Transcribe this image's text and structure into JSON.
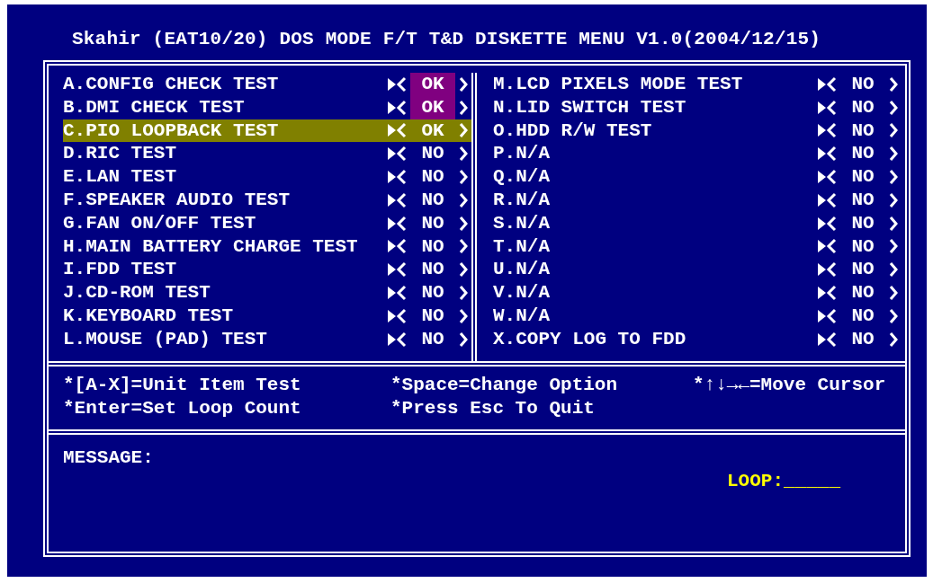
{
  "title": "Skahir (EAT10/20) DOS MODE F/T T&D DISKETTE MENU V1.0(2004/12/15)",
  "columns": [
    {
      "items": [
        {
          "label": "A.CONFIG CHECK TEST",
          "value": "OK",
          "marked": true,
          "selected": false
        },
        {
          "label": "B.DMI CHECK TEST",
          "value": "OK",
          "marked": true,
          "selected": false
        },
        {
          "label": "C.PIO LOOPBACK TEST",
          "value": "OK",
          "marked": false,
          "selected": true
        },
        {
          "label": "D.RIC TEST",
          "value": "NO",
          "marked": false,
          "selected": false
        },
        {
          "label": "E.LAN TEST",
          "value": "NO",
          "marked": false,
          "selected": false
        },
        {
          "label": "F.SPEAKER AUDIO TEST",
          "value": "NO",
          "marked": false,
          "selected": false
        },
        {
          "label": "G.FAN ON/OFF TEST",
          "value": "NO",
          "marked": false,
          "selected": false
        },
        {
          "label": "H.MAIN BATTERY CHARGE TEST",
          "value": "NO",
          "marked": false,
          "selected": false
        },
        {
          "label": "I.FDD TEST",
          "value": "NO",
          "marked": false,
          "selected": false
        },
        {
          "label": "J.CD-ROM TEST",
          "value": "NO",
          "marked": false,
          "selected": false
        },
        {
          "label": "K.KEYBOARD TEST",
          "value": "NO",
          "marked": false,
          "selected": false
        },
        {
          "label": "L.MOUSE (PAD) TEST",
          "value": "NO",
          "marked": false,
          "selected": false
        }
      ]
    },
    {
      "items": [
        {
          "label": "M.LCD PIXELS MODE TEST",
          "value": "NO",
          "marked": false,
          "selected": false
        },
        {
          "label": "N.LID SWITCH TEST",
          "value": "NO",
          "marked": false,
          "selected": false
        },
        {
          "label": "O.HDD R/W TEST",
          "value": "NO",
          "marked": false,
          "selected": false
        },
        {
          "label": "P.N/A",
          "value": "NO",
          "marked": false,
          "selected": false
        },
        {
          "label": "Q.N/A",
          "value": "NO",
          "marked": false,
          "selected": false
        },
        {
          "label": "R.N/A",
          "value": "NO",
          "marked": false,
          "selected": false
        },
        {
          "label": "S.N/A",
          "value": "NO",
          "marked": false,
          "selected": false
        },
        {
          "label": "T.N/A",
          "value": "NO",
          "marked": false,
          "selected": false
        },
        {
          "label": "U.N/A",
          "value": "NO",
          "marked": false,
          "selected": false
        },
        {
          "label": "V.N/A",
          "value": "NO",
          "marked": false,
          "selected": false
        },
        {
          "label": "W.N/A",
          "value": "NO",
          "marked": false,
          "selected": false
        },
        {
          "label": "X.COPY LOG TO FDD",
          "value": "NO",
          "marked": false,
          "selected": false
        }
      ]
    }
  ],
  "help": [
    [
      "*[A-X]=Unit Item Test",
      "*Enter=Set Loop Count"
    ],
    [
      "*Space=Change Option",
      "*Press Esc To Quit"
    ],
    [
      "*↑↓→←=Move Cursor"
    ]
  ],
  "message": {
    "label": "MESSAGE:",
    "loop": "LOOP:_____"
  }
}
